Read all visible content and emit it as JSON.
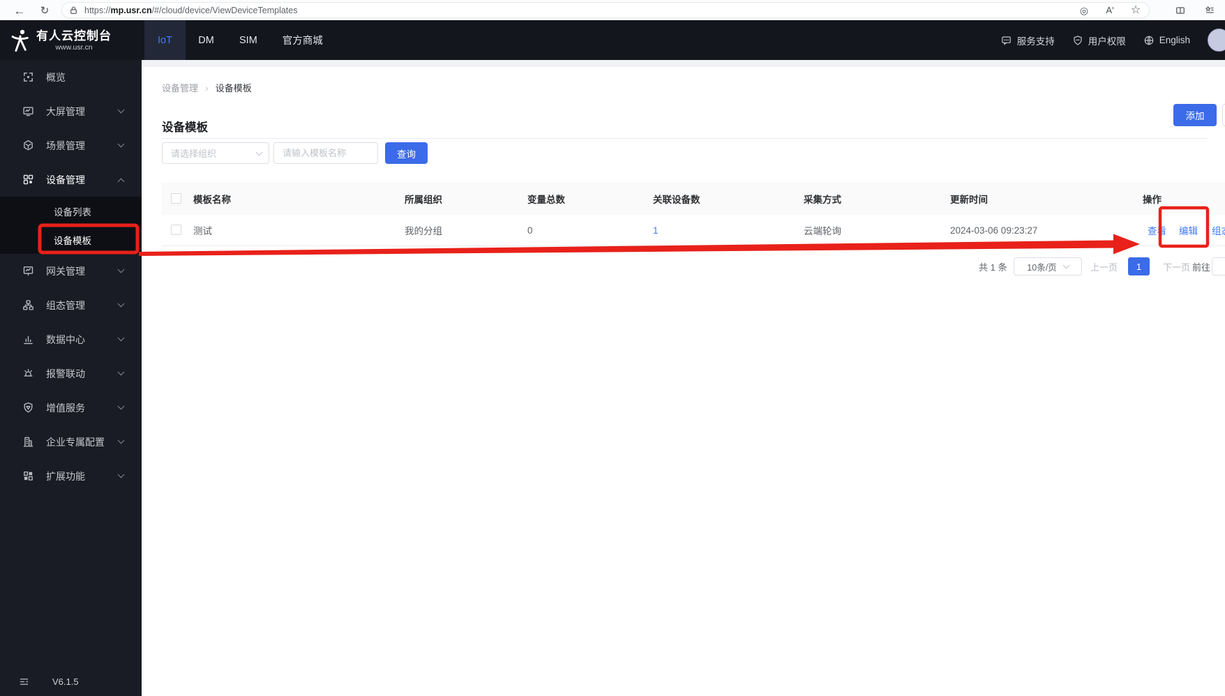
{
  "browser": {
    "url_prefix": "https://",
    "url_domain": "mp.usr.cn",
    "url_path": "/#/cloud/device/ViewDeviceTemplates"
  },
  "topnav": {
    "logo_title": "有人云控制台",
    "logo_subtitle": "www.usr.cn",
    "tabs": [
      {
        "label": "IoT",
        "active": true
      },
      {
        "label": "DM",
        "active": false
      },
      {
        "label": "SIM",
        "active": false
      },
      {
        "label": "官方商城",
        "active": false
      }
    ],
    "support": "服务支持",
    "permissions": "用户权限",
    "language": "English"
  },
  "sidebar": {
    "items": [
      {
        "label": "概览",
        "icon": "overview-icon"
      },
      {
        "label": "大屏管理",
        "icon": "big-screen-icon"
      },
      {
        "label": "场景管理",
        "icon": "scene-icon"
      },
      {
        "label": "设备管理",
        "icon": "device-icon",
        "expanded": true
      },
      {
        "label": "网关管理",
        "icon": "gateway-icon"
      },
      {
        "label": "组态管理",
        "icon": "scada-icon"
      },
      {
        "label": "数据中心",
        "icon": "data-center-icon"
      },
      {
        "label": "报警联动",
        "icon": "alarm-icon"
      },
      {
        "label": "增值服务",
        "icon": "value-added-icon"
      },
      {
        "label": "企业专属配置",
        "icon": "enterprise-icon"
      },
      {
        "label": "扩展功能",
        "icon": "extension-icon"
      }
    ],
    "submenu": [
      {
        "label": "设备列表",
        "active": false
      },
      {
        "label": "设备模板",
        "active": true
      }
    ],
    "version": "V6.1.5"
  },
  "breadcrumb": {
    "parent": "设备管理",
    "current": "设备模板"
  },
  "page": {
    "title": "设备模板",
    "add_button": "添加"
  },
  "filters": {
    "org_placeholder": "请选择组织",
    "name_placeholder": "请输入模板名称",
    "search_button": "查询"
  },
  "table": {
    "headers": [
      "模板名称",
      "所属组织",
      "变量总数",
      "关联设备数",
      "采集方式",
      "更新时间",
      "操作"
    ],
    "row": {
      "name": "测试",
      "org": "我的分组",
      "variable_total": "0",
      "linked_devices": "1",
      "collect_method": "云端轮询",
      "update_time": "2024-03-06 09:23:27",
      "actions": {
        "view": "查看",
        "edit": "编辑",
        "scada": "组态"
      }
    }
  },
  "pagination": {
    "total": "共 1 条",
    "page_size": "10条/页",
    "prev": "上一页",
    "current_page": "1",
    "next": "下一页",
    "goto_label": "前往"
  },
  "colors": {
    "accent_blue": "#3b6be8",
    "link_blue": "#3e79f7",
    "annotation_red": "#e8211a",
    "topnav_bg": "#14161d",
    "sidebar_bg": "#191c24",
    "submenu_bg": "#0d0f14"
  }
}
